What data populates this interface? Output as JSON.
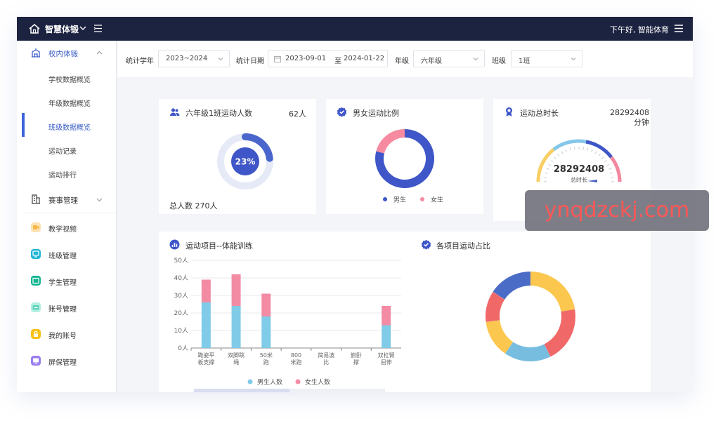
{
  "topbar": {
    "brand": "智慧体锻",
    "greeting": "下午好, 智能体育"
  },
  "sidebar": {
    "group1": {
      "label": "校内体锻",
      "icon": "school-building-icon"
    },
    "subitems": [
      {
        "label": "学校数据概览"
      },
      {
        "label": "年级数据概览"
      },
      {
        "label": "班级数据概览",
        "active": true
      },
      {
        "label": "运动记录"
      },
      {
        "label": "运动排行"
      }
    ],
    "group2": {
      "label": "赛事管理",
      "icon": "building-icon"
    },
    "items": [
      {
        "label": "教学视频",
        "color": "#f7c46b"
      },
      {
        "label": "班级管理",
        "color": "#1fb5d6"
      },
      {
        "label": "学生管理",
        "color": "#12b591"
      },
      {
        "label": "账号管理",
        "color": "#7edfc9"
      },
      {
        "label": "我的账号",
        "color": "#f5b90f"
      },
      {
        "label": "屏保管理",
        "color": "#8d6fe3"
      }
    ]
  },
  "filters": {
    "year_label": "统计学年",
    "year_value": "2023~2024",
    "date_label": "统计日期",
    "date_start": "2023-09-01",
    "date_sep": "至",
    "date_end": "2024-01-22",
    "grade_label": "年级",
    "grade_value": "六年级",
    "class_label": "班级",
    "class_value": "1班"
  },
  "card_active": {
    "title": "六年级1班运动人数",
    "count": "62人",
    "percent_label": "23%",
    "percent": 0.23,
    "total": "总人数 270人"
  },
  "card_gender": {
    "title": "男女运动比例",
    "legend": [
      "男生",
      "女生"
    ],
    "male_ratio": 0.79,
    "female_ratio": 0.21,
    "colors": {
      "male": "#3f56c8",
      "female": "#f58aa0"
    }
  },
  "card_duration": {
    "title": "运动总时长",
    "value_line1": "28292408",
    "value_line2": "分钟",
    "gauge_value": "28292408",
    "gauge_caption": "总时长"
  },
  "card_project": {
    "title": "运动项目--体能训练"
  },
  "card_share": {
    "title": "各项目运动占比"
  },
  "chart_data": [
    {
      "type": "bar",
      "title": "运动项目--体能训练",
      "categories": [
        "跪姿平板支撑",
        "双脚跳绳",
        "50米跑",
        "800米跑",
        "简易波比",
        "俯卧撑",
        "双杠臂屈伸"
      ],
      "series": [
        {
          "name": "男生人数",
          "values": [
            26,
            24,
            18,
            0,
            0,
            0,
            13
          ]
        },
        {
          "name": "女生人数",
          "values": [
            13,
            18,
            13,
            0,
            0,
            0,
            11
          ]
        }
      ],
      "ylim": [
        0,
        50
      ],
      "yticks": [
        "0人",
        "10人",
        "20人",
        "30人",
        "40人",
        "50人"
      ],
      "legend": [
        "男生人数",
        "女生人数"
      ],
      "colors": [
        "#7fcbe8",
        "#f38ba4"
      ],
      "legend_position": "bottom"
    },
    {
      "type": "pie",
      "title": "各项目运动占比",
      "values": [
        20,
        18,
        15,
        12,
        10,
        14
      ],
      "colors": [
        "#fbc74f",
        "#f16868",
        "#77bde0",
        "#fbc74f",
        "#f16868",
        "#4b6cc6"
      ]
    }
  ]
}
